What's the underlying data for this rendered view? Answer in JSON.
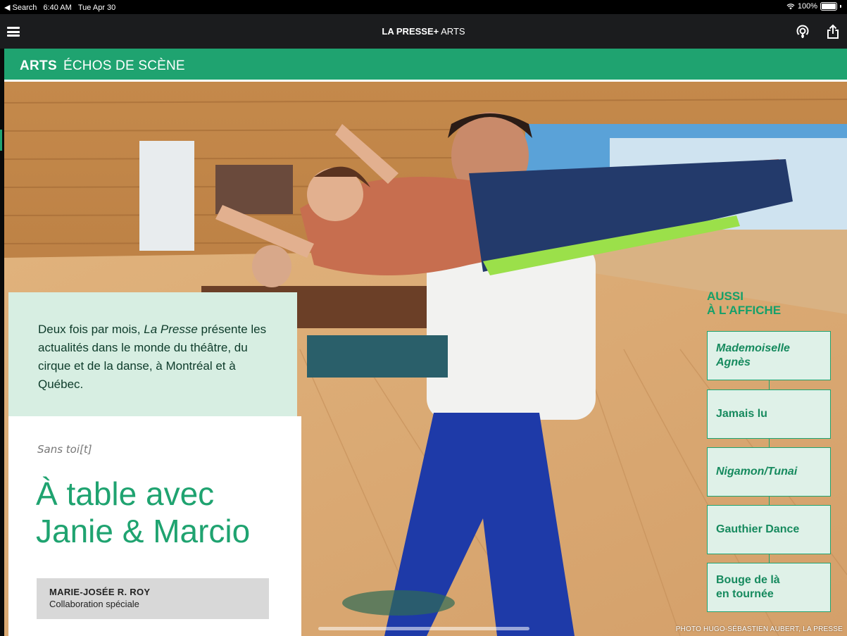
{
  "status_bar": {
    "back_label": "◀ Search",
    "time": "6:40 AM",
    "date": "Tue Apr 30",
    "battery": "100%"
  },
  "app_bar": {
    "brand": "LA PRESSE+",
    "section": "ARTS"
  },
  "section_header": {
    "label": "ARTS",
    "subtitle": "ÉCHOS DE SCÈNE"
  },
  "intro": {
    "line_a": "Deux fois par mois, ",
    "publication": "La Presse",
    "line_b": " présente les actualités dans le monde du théâtre, du cirque et de la danse, à Montréal et à Québec."
  },
  "article": {
    "kicker": "Sans toi[t]",
    "headline_line1": "À table avec",
    "headline_line2": "Janie & Marcio",
    "author": "MARIE-JOSÉE R. ROY",
    "author_role": "Collaboration spéciale"
  },
  "aside": {
    "title_line1": "AUSSI",
    "title_line2": "À L'AFFICHE",
    "items": [
      {
        "label": "Mademoiselle Agnès"
      },
      {
        "label": "Jamais lu"
      },
      {
        "label": "Nigamon/Tunai"
      },
      {
        "label": "Gauthier Dance"
      },
      {
        "label": "Bouge de là en tournée"
      }
    ]
  },
  "photo": {
    "credit": "PHOTO HUGO-SÉBASTIEN AUBERT, LA PRESSE"
  },
  "colors": {
    "accent": "#1fa370",
    "intro_bg": "#d7eee2",
    "app_bar": "#1b1c1e"
  }
}
